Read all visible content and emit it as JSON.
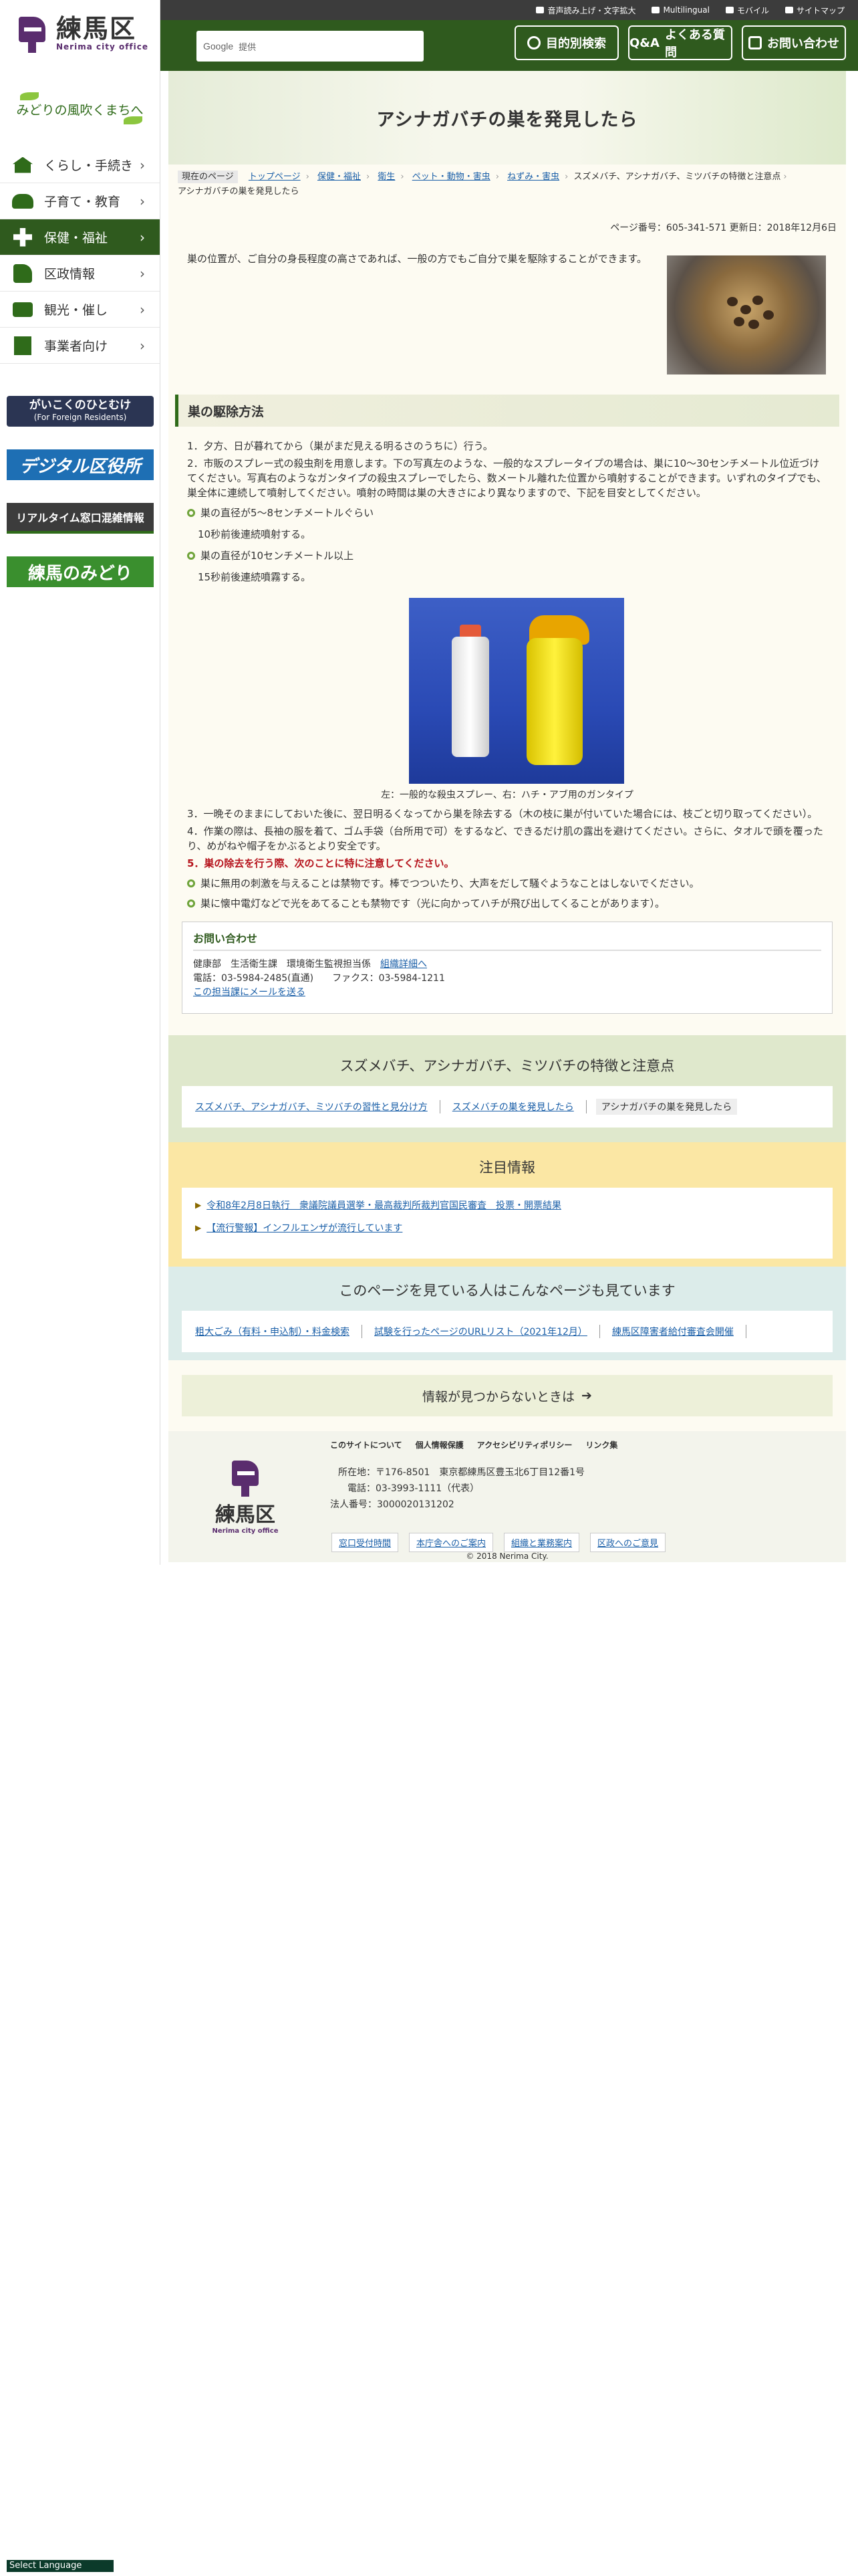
{
  "sidebar": {
    "logo_jp": "練馬区",
    "logo_en": "Nerima city office",
    "tagline": "みどりの風吹くまちへ",
    "nav": [
      {
        "label": "くらし・手続き",
        "icon": "house-icon"
      },
      {
        "label": "子育て・教育",
        "icon": "child-icon"
      },
      {
        "label": "保健・福祉",
        "icon": "health-icon"
      },
      {
        "label": "区政情報",
        "icon": "city-icon"
      },
      {
        "label": "観光・催し",
        "icon": "camera-icon"
      },
      {
        "label": "事業者向け",
        "icon": "building-icon"
      }
    ],
    "banners": {
      "foreign": "がいこくのひとむけ",
      "foreign_sub": "(For Foreign Residents)",
      "digital": "デジタル区役所",
      "realtime": "リアルタイム窓口混雑情報",
      "midori": "練馬のみどり"
    }
  },
  "topbar": {
    "links": [
      "音声読み上げ・文字拡大",
      "Multilingual",
      "モバイル",
      "サイトマップ"
    ]
  },
  "header": {
    "search_placeholder": "提供",
    "google_label": "Google",
    "btn_purpose": "目的別検索",
    "btn_faq": "よくある質問",
    "btn_faq_prefix": "Q&A",
    "btn_contact": "お問い合わせ"
  },
  "page": {
    "title": "アシナガバチの巣を発見したら",
    "breadcrumb_here": "現在のページ",
    "breadcrumb": [
      "トップページ",
      "保健・福祉",
      "衛生",
      "ペット・動物・害虫",
      "ねずみ・害虫",
      "スズメバチ、アシナガバチ、ミツバチの特徴と注意点"
    ],
    "breadcrumb_current": "アシナガバチの巣を発見したら",
    "page_number": "ページ番号：605-341-571",
    "updated": "更新日：2018年12月6日",
    "intro": "巣の位置が、ご自分の身長程度の高さであれば、一般の方でもご自分で巣を駆除することができます。",
    "h2_removal": "巣の駆除方法",
    "step1": "1．夕方、日が暮れてから（巣がまだ見える明るさのうちに）行う。",
    "step2": "2．市販のスプレー式の殺虫剤を用意します。下の写真左のような、一般的なスプレータイプの場合は、巣に10～30センチメートル位近づけてください。写真右のようなガンタイプの殺虫スプレーでしたら、数メートル離れた位置から噴射することができます。いずれのタイプでも、巣全体に連続して噴射してください。噴射の時間は巣の大きさにより異なりますので、下記を目安としてください。",
    "bullet1": "巣の直径が5～8センチメートルぐらい",
    "bullet1_sub": "10秒前後連続噴射する。",
    "bullet2": "巣の直径が10センチメートル以上",
    "bullet2_sub": "15秒前後連続噴霧する。",
    "spray_caption": "左：一般的な殺虫スプレー、右：ハチ・アブ用のガンタイプ",
    "step3": "3．一晩そのままにしておいた後に、翌日明るくなってから巣を除去する（木の枝に巣が付いていた場合には、枝ごと切り取ってください）。",
    "step4": "4．作業の際は、長袖の服を着て、ゴム手袋（台所用で可）をするなど、できるだけ肌の露出を避けてください。さらに、タオルで頭を覆ったり、めがねや帽子をかぶるとより安全です。",
    "step5": "5．巣の除去を行う際、次のことに特に注意してください。",
    "warn1": "巣に無用の刺激を与えることは禁物です。棒でつついたり、大声をだして騒ぐようなことはしないでください。",
    "warn2": "巣に懐中電灯などで光をあてることも禁物です（光に向かってハチが飛び出してくることがあります）。"
  },
  "contact": {
    "title": "お問い合わせ",
    "dept": "健康部　生活衛生課　環境衛生監視担当係",
    "dept_link": "組織詳細へ",
    "phone": "電話：03-5984-2485(直通)　　ファクス：03-5984-1211",
    "mail_link": "この担当課にメールを送る"
  },
  "related": {
    "title": "スズメバチ、アシナガバチ、ミツバチの特徴と注意点",
    "links": [
      "スズメバチ、アシナガバチ、ミツバチの習性と見分け方",
      "スズメバチの巣を発見したら"
    ],
    "current": "アシナガバチの巣を発見したら"
  },
  "notice": {
    "title": "注目情報",
    "items": [
      "令和8年2月8日執行　衆議院議員選挙・最高裁判所裁判官国民審査　投票・開票結果",
      "【流行警報】インフルエンザが流行しています"
    ]
  },
  "also_viewed": {
    "title": "このページを見ている人はこんなページも見ています",
    "links": [
      "粗大ごみ（有料・申込制）・料金検索",
      "試験を行ったページのURLリスト（2021年12月）",
      "練馬区障害者給付審査会開催"
    ]
  },
  "not_found": "情報が見つからないときは",
  "footer": {
    "logo_jp": "練馬区",
    "logo_en": "Nerima city office",
    "links": [
      "このサイトについて",
      "個人情報保護",
      "アクセシビリティポリシー",
      "リンク集"
    ],
    "address": "所在地：〒176-8501　東京都練馬区豊玉北6丁目12番1号",
    "phone": "電話：03-3993-1111（代表）",
    "corp_no": "法人番号：3000020131202",
    "buttons": [
      "窓口受付時間",
      "本庁舎へのご案内",
      "組織と業務案内",
      "区政へのご意見"
    ],
    "copyright": "© 2018 Nerima City."
  },
  "select_language": "Select Language"
}
